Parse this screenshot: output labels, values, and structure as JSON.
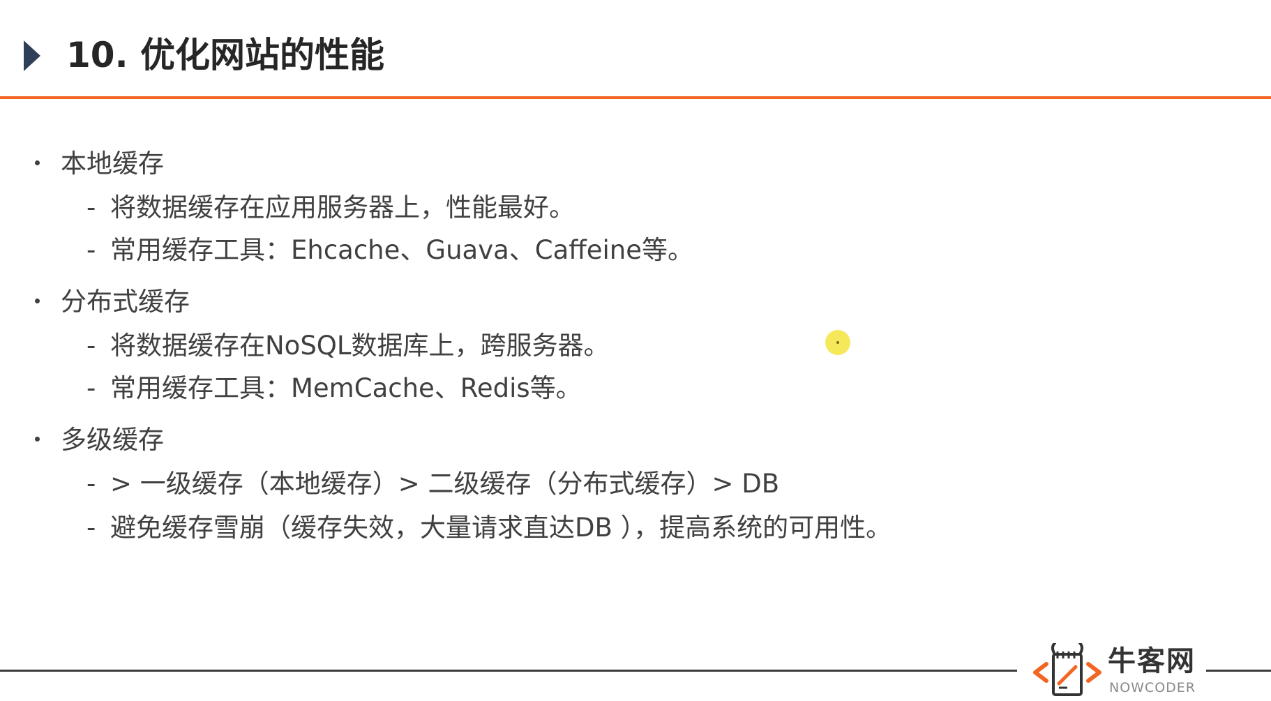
{
  "title": "10. 优化网站的性能",
  "sections": [
    {
      "heading": "本地缓存",
      "items": [
        "将数据缓存在应用服务器上，性能最好。",
        "常用缓存工具：Ehcache、Guava、Caffeine等。"
      ]
    },
    {
      "heading": "分布式缓存",
      "items": [
        "将数据缓存在NoSQL数据库上，跨服务器。",
        "常用缓存工具：MemCache、Redis等。"
      ]
    },
    {
      "heading": "多级缓存",
      "items": [
        "> 一级缓存（本地缓存）> 二级缓存（分布式缓存）> DB",
        "避免缓存雪崩（缓存失效，大量请求直达DB ），提高系统的可用性。"
      ]
    }
  ],
  "bullet_symbol": "•",
  "dash_symbol": "-",
  "logo": {
    "brand": "牛客网",
    "sub": "NOWCODER",
    "icon": "nowcoder-logo-icon"
  },
  "colors": {
    "accent": "#f26522",
    "title_arrow": "#2f3f58",
    "logo_orange": "#f26522",
    "cursor_highlight": "#f5e64a"
  }
}
